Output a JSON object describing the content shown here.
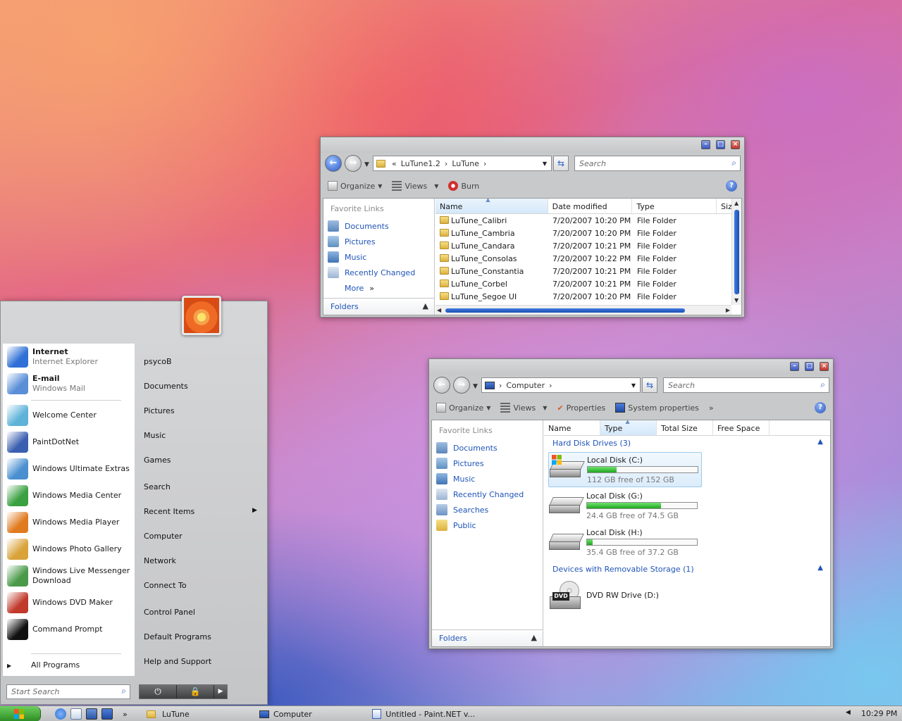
{
  "explorer1": {
    "address": {
      "chevron": "«",
      "path": [
        "LuTune1.2",
        "LuTune"
      ]
    },
    "search_placeholder": "Search",
    "toolbar": {
      "organize": "Organize",
      "views": "Views",
      "burn": "Burn"
    },
    "favorite_links_title": "Favorite Links",
    "favorite_links": [
      "Documents",
      "Pictures",
      "Music",
      "Recently Changed",
      "More"
    ],
    "folders_label": "Folders",
    "columns": [
      "Name",
      "Date modified",
      "Type",
      "Siz"
    ],
    "rows": [
      {
        "name": "LuTune_Calibri",
        "date": "7/20/2007 10:20 PM",
        "type": "File Folder"
      },
      {
        "name": "LuTune_Cambria",
        "date": "7/20/2007 10:20 PM",
        "type": "File Folder"
      },
      {
        "name": "LuTune_Candara",
        "date": "7/20/2007 10:21 PM",
        "type": "File Folder"
      },
      {
        "name": "LuTune_Consolas",
        "date": "7/20/2007 10:22 PM",
        "type": "File Folder"
      },
      {
        "name": "LuTune_Constantia",
        "date": "7/20/2007 10:21 PM",
        "type": "File Folder"
      },
      {
        "name": "LuTune_Corbel",
        "date": "7/20/2007 10:21 PM",
        "type": "File Folder"
      },
      {
        "name": "LuTune_Segoe UI",
        "date": "7/20/2007 10:20 PM",
        "type": "File Folder"
      }
    ]
  },
  "explorer2": {
    "address": {
      "path": [
        "Computer"
      ]
    },
    "search_placeholder": "Search",
    "toolbar": {
      "organize": "Organize",
      "views": "Views",
      "properties": "Properties",
      "system_properties": "System properties",
      "more": "»"
    },
    "favorite_links_title": "Favorite Links",
    "favorite_links": [
      "Documents",
      "Pictures",
      "Music",
      "Recently Changed",
      "Searches",
      "Public"
    ],
    "folders_label": "Folders",
    "columns": [
      "Name",
      "Type",
      "Total Size",
      "Free Space"
    ],
    "groups": {
      "hard_disks": "Hard Disk Drives (3)",
      "removable": "Devices with Removable Storage (1)"
    },
    "drives": [
      {
        "name": "Local Disk (C:)",
        "free": "112 GB free of 152 GB",
        "used_fraction": 0.26
      },
      {
        "name": "Local Disk (G:)",
        "free": "24.4 GB free of 74.5 GB",
        "used_fraction": 0.67
      },
      {
        "name": "Local Disk (H:)",
        "free": "35.4 GB free of 37.2 GB",
        "used_fraction": 0.05
      }
    ],
    "dvd": {
      "name": "DVD RW Drive (D:)",
      "label": "DVD"
    }
  },
  "start_menu": {
    "programs": [
      {
        "title": "Internet",
        "subtitle": "Internet Explorer",
        "color": "#2f6fd6"
      },
      {
        "title": "E-mail",
        "subtitle": "Windows Mail",
        "color": "#5a8fd8"
      },
      {
        "title": "Welcome Center",
        "color": "#5fb3d9"
      },
      {
        "title": "PaintDotNet",
        "color": "#3b5fb0"
      },
      {
        "title": "Windows Ultimate Extras",
        "color": "#4a8fd0"
      },
      {
        "title": "Windows Media Center",
        "color": "#3aa040"
      },
      {
        "title": "Windows Media Player",
        "color": "#e07a1f"
      },
      {
        "title": "Windows Photo Gallery",
        "color": "#d9a33a"
      },
      {
        "title": "Windows Live Messenger Download",
        "color": "#4a9a4a"
      },
      {
        "title": "Windows DVD Maker",
        "color": "#c0392b"
      },
      {
        "title": "Command Prompt",
        "color": "#111111"
      }
    ],
    "all_programs": "All Programs",
    "right_links": [
      "psycoB",
      "Documents",
      "Pictures",
      "Music",
      "Games",
      "Search",
      "Recent Items",
      "Computer",
      "Network",
      "Connect To",
      "Control Panel",
      "Default Programs",
      "Help and Support"
    ],
    "search_placeholder": "Start Search"
  },
  "taskbar": {
    "tasks": [
      "LuTune",
      "Computer",
      "Untitled - Paint.NET v..."
    ],
    "more": "»",
    "clock": "10:29 PM"
  }
}
